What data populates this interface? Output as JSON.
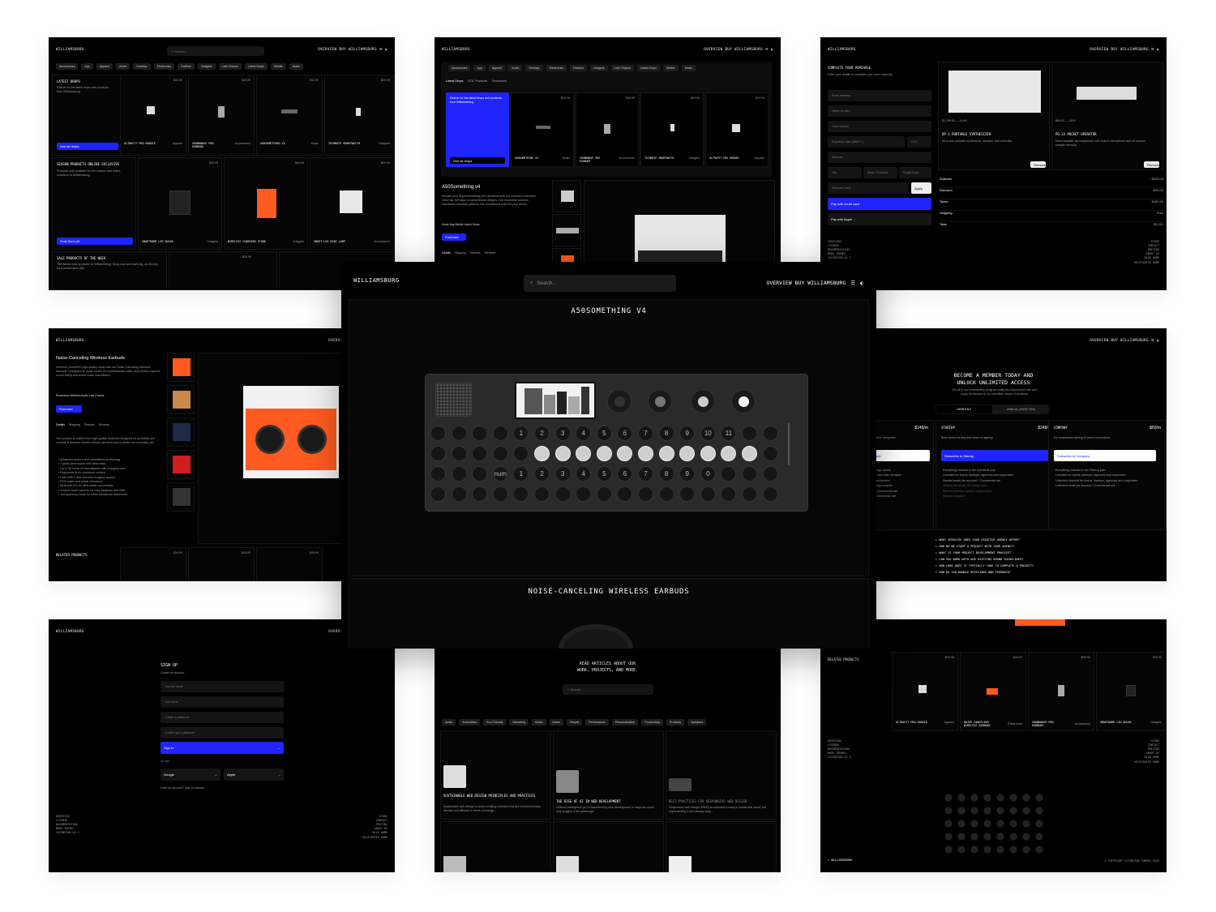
{
  "brand": "WILLIAMSBURG",
  "nav_right": "OVERVIEW BUY WILLIAMSBURG",
  "search_placeholder": "Search...",
  "categories": [
    "Accessories",
    "App",
    "Apparel",
    "Audio",
    "Desktop",
    "Electronics",
    "Fashion",
    "Gadgets",
    "Last Chance",
    "Latest Drops",
    "Mobile",
    "Music"
  ],
  "p1": {
    "latest_title": "LATEST DROPS",
    "latest_desc": "Search for the latest drops and products from Williamsburg.",
    "see_all": "See all drops",
    "products": [
      {
        "name": "ULTRAFIT PRO HOODIE",
        "cat": "Apparel",
        "price": "$24.99"
      },
      {
        "name": "SOUNDWAVE PRO EARBUDS",
        "cat": "Accessories",
        "price": "$49.99"
      },
      {
        "name": "A50SOMETHING V4",
        "cat": "Music",
        "price": "$15.99"
      },
      {
        "name": "TECHMATE SMARTWATCH",
        "cat": "Gadgets",
        "price": "$29.99"
      }
    ],
    "season_title": "SEASON PRODUCTS ONLINE EXCLUSIVE",
    "season_desc": "Products only available for the season and online, exclusive to Williamsburg.",
    "grab": "Grab them all",
    "season_products": [
      {
        "name": "SMARTHOME LED BULBS",
        "cat": "Gadgets",
        "price": "$29.99"
      },
      {
        "name": "WIRELESS CHARGING STAND",
        "cat": "Gadgets",
        "price": "$49.99"
      },
      {
        "name": "SMART LED DESK LAMP",
        "cat": "Accessories",
        "price": "$29.99"
      }
    ],
    "sale_title": "SALE PRODUCTS OF THE WEEK",
    "sale_desc": "This weeks sale products on Williamsburg. Shop now and save big, as it's only for a limited time offer.",
    "sale_price": "$39.99"
  },
  "p2": {
    "tabs": [
      "Latest Drops",
      "EOL Products",
      "Resources"
    ],
    "promo": "Search for the latest drops and products from Williamsburg.",
    "see_all": "See all drops",
    "products": [
      {
        "name": "A50SOMETHING V4",
        "cat": "Music",
        "price": "$15.99"
      },
      {
        "name": "SOUNDWAVE PRO EARBUDS",
        "cat": "Accessories",
        "price": "$49.99"
      },
      {
        "name": "TECHMATE SMARTWATCH",
        "cat": "Gadgets",
        "price": "$29.99"
      },
      {
        "name": "ULTRAFIT PRO HOODIE",
        "cat": "Apparel",
        "price": "$24.99"
      }
    ],
    "detail_title": "A50Something v4",
    "detail_desc": "Elevate your SuperSomething v4's aesthetic with our exclusive collection. Gone are the days of conventional designs. Our innovative process transforms standard patterns into exceptional ones for your device.",
    "detail_tags": "Music  App  Mobile  Latest Drops",
    "purchase": "Purchase",
    "detail_tabs": [
      "Details",
      "Shipping",
      "Returns",
      "Reviews"
    ]
  },
  "p3": {
    "title": "COMPLETE YOUR PURCHASE",
    "subtitle": "Enter your details to complete your order securely.",
    "fields": [
      "Email address",
      "Name on card",
      "Card number",
      "Expiration date (MM/YY)",
      "CVC",
      "Address",
      "City",
      "State / Province",
      "Postal Code",
      "Discount Code"
    ],
    "apply": "Apply",
    "pay_card": "Pay with credit card",
    "pay_apple": "Pay with Apple",
    "items": [
      {
        "price": "$1,299.00 — 4,449",
        "name": "OP-1 PORTABLE SYNTHESIZER",
        "desc": "All-in-one portable synthesizer, sampler, and controller.",
        "remove": "Remove"
      },
      {
        "price": "$89.00 — 4449",
        "name": "PO-33 POCKET OPERATOR",
        "desc": "Micro sampler and sequencer with built-in microphone and 40 second sample memory.",
        "remove": "Remove"
      }
    ],
    "summary": [
      {
        "label": "Subtotal",
        "value": "$400.00"
      },
      {
        "label": "Discount",
        "value": "-$30.00"
      },
      {
        "label": "Taxes",
        "value": "$400.99"
      },
      {
        "label": "Shipping",
        "value": "Free"
      },
      {
        "label": "Total",
        "value": "$3,019"
      }
    ],
    "footer_left": [
      "OVERVIEW",
      "LICENSE",
      "DOCUMENTATION",
      "MORE THEMES",
      "LEXINGTON UX 3"
    ],
    "footer_right": [
      "STORE",
      "CONTACT",
      "PRICING",
      "ABOUT US",
      "BLOG HOME",
      "HELPCENTER HOME"
    ]
  },
  "p4": {
    "title": "Noise-Canceling Wireless Earbuds",
    "desc": "Immerse yourself in high-quality audio with our Noise-Canceling Wireless Earbuds. Designed for music lovers and professionals alike, they deliver superior sound clarity and active noise cancellation.",
    "tags": "Electronics  Wireless  Audio  Last Chance",
    "purchase": "Purchase",
    "tabs": [
      "Details",
      "Shipping",
      "Returns",
      "Reviews"
    ],
    "body": "This product is crafted from high-quality materials designed for durability and comfort. It features modern design elements and is perfect for everyday use.",
    "bullets": [
      "Advanced active noise cancellation technology",
      "Crystal-clear sound with deep bass",
      "Up to 30 hours of total playtime with charging case",
      "Ergonomic fit for maximum comfort",
      "Fast USB-C and wireless charging support",
      "IPX5 water and sweat resistance",
      "Bluetooth 5.3 for ultra-stable connectivity",
      "Intuitive touch controls for easy playback and calls",
      "Transparency mode for better situational awareness"
    ],
    "related": "RELATED PRODUCTS",
    "related_prices": [
      "$24.99",
      "$39.99",
      "$49.99"
    ]
  },
  "p6": {
    "title_1": "BECOME A MEMBER TODAY AND",
    "title_2": "UNLOCK UNLIMITED ACCESS",
    "subtitle": "Enroll in our membership program today at a discounted rate and enjoy full access to our incredible lineup of products.",
    "toggle": [
      "MONTHLY",
      "ANNUAL (SAVE 15%)"
    ],
    "plans": [
      {
        "price": "$149/m",
        "name": "",
        "desc": "endent designers",
        "cta": "ual",
        "features": [
          "design assets",
          "ion and style designer",
          "development",
          "design projects",
          "t *   Commercial use",
          "*   Commercial use"
        ]
      },
      {
        "name": "STARTUP",
        "price": "$249/m",
        "desc": "Best choice for any size team or agency.",
        "cta": "Subscribe to Startup",
        "features": [
          "Everything included in the Individual plan",
          "Licensed for teams, startups, agencies and corporates",
          "Seeded seats per account *    Commercial use",
          "Missing advanced 3D design tools",
          "Without premium system collaboration",
          "Standard support"
        ]
      },
      {
        "name": "COMPANY",
        "price": "$50/m",
        "desc": "For businesses aiming to lead in innovation.",
        "cta": "Subscribe to Company",
        "features": [
          "Everything included in the Startup plan",
          "Licensed for teams, startups, agencies and corporates",
          "Unlimited licensed for teams, startups, agencies and corporates",
          "Unlimited seats per account *    Commercial use"
        ]
      }
    ],
    "faq": [
      "WHAT SERVICES DOES YOUR CREATIVE AGENCY OFFER?",
      "HOW DO WE START A PROJECT WITH YOUR AGENCY?",
      "WHAT IS YOUR PROJECT DEVELOPMENT PROCESS?",
      "CAN YOU WORK WITH OUR EXISTING BRAND GUIDELINES?",
      "HOW LONG DOES IT TYPICALLY TAKE TO COMPLETE A PROJECT?",
      "HOW DO YOU HANDLE REVISIONS AND FEEDBACK?"
    ]
  },
  "p7": {
    "title": "SIGN UP",
    "subtitle": "Create an account",
    "fields": [
      "Your full name",
      "Your email",
      "Create a password",
      "Confirm your password"
    ],
    "signin": "Sign In",
    "or": "Or use",
    "google": "Google",
    "apple": "Apple",
    "have_account": "Have an account? Sign in instead",
    "footer_left": [
      "OVERVIEW",
      "LICENSE",
      "DOCUMENTATION",
      "MORE THEMES",
      "LEXINGTON UX 3"
    ],
    "footer_right": [
      "STORE",
      "CONTACT",
      "PRICING",
      "ABOUT US",
      "BLOG HOME",
      "HELPCENTER HOME"
    ]
  },
  "p8": {
    "title_1": "READ ARTICLES ABOUT OUR",
    "title_2": "WORK, PROJECTS, AND MORE.",
    "search": "Search...",
    "chips": [
      "Audio",
      "Automation",
      "Eco Friendly",
      "Marketing",
      "Notes",
      "Notes",
      "People",
      "Performance",
      "Personalization",
      "Productivity",
      "Products",
      "Speakers"
    ],
    "articles": [
      {
        "title": "SUSTAINABLE WEB DESIGN PRINCIPLES AND PRACTICES",
        "desc": "Sustainable web design is about creating websites that are environmentally friendly and efficient in terms of energy..."
      },
      {
        "title": "THE RISE OF AI IN WEB DEVELOPMENT",
        "desc": "Artificial Intelligence (AI) is transforming web development in ways we could only imagine a few years ago."
      },
      {
        "title": "BEST PRACTICES FOR RESPONSIVE WEB DESIGN",
        "desc": "Responsive web design (RWD) is essential in today's mobile-first world, but implementing it isn't always easy..."
      }
    ]
  },
  "p9": {
    "related": "RELATED PRODUCTS",
    "products": [
      {
        "name": "ULTRAFIT PRO HOODIE",
        "cat": "Apparel",
        "price": "$24.99"
      },
      {
        "name": "NOISE-CANCELING WIRELESS EARBUDS",
        "cat": "Electronics",
        "price": "$34.99"
      },
      {
        "name": "SOUNDWAVE PRO EARBUDS",
        "cat": "Accessories",
        "price": "$49.99"
      },
      {
        "name": "SMARTHOME LED BULBS",
        "cat": "Gadgets",
        "price": "$29.99"
      }
    ],
    "footer_left": [
      "OVERVIEW",
      "LICENSE",
      "DOCUMENTATION",
      "MORE THEMES",
      "LEXINGTON UX 3"
    ],
    "footer_right": [
      "STORE",
      "CONTACT",
      "PRICING",
      "ABOUT US",
      "BLOG HOME",
      "HELPCENTER HOME"
    ],
    "copyright": "© COPYRIGHT LEXINGTON THEMES 2025"
  },
  "center": {
    "brand": "WILLIAMSBURG",
    "search": "Search...",
    "nav_right": "OVERVIEW BUY WILLIAMSBURG",
    "product_1": "A50SOMETHING V4",
    "product_2": "NOISE-CANCELING WIRELESS EARBUDS",
    "keys_top": [
      "1",
      "2",
      "3",
      "4",
      "5",
      "6",
      "7",
      "8",
      "9",
      "10",
      "11"
    ],
    "keys_bottom": [
      "num",
      "1",
      "2",
      "3",
      "4",
      "5",
      "6",
      "7",
      "8",
      "9",
      "0"
    ]
  },
  "colors": {
    "accent": "#2024ff",
    "orange": "#ff5a1f",
    "bg": "#000000"
  }
}
